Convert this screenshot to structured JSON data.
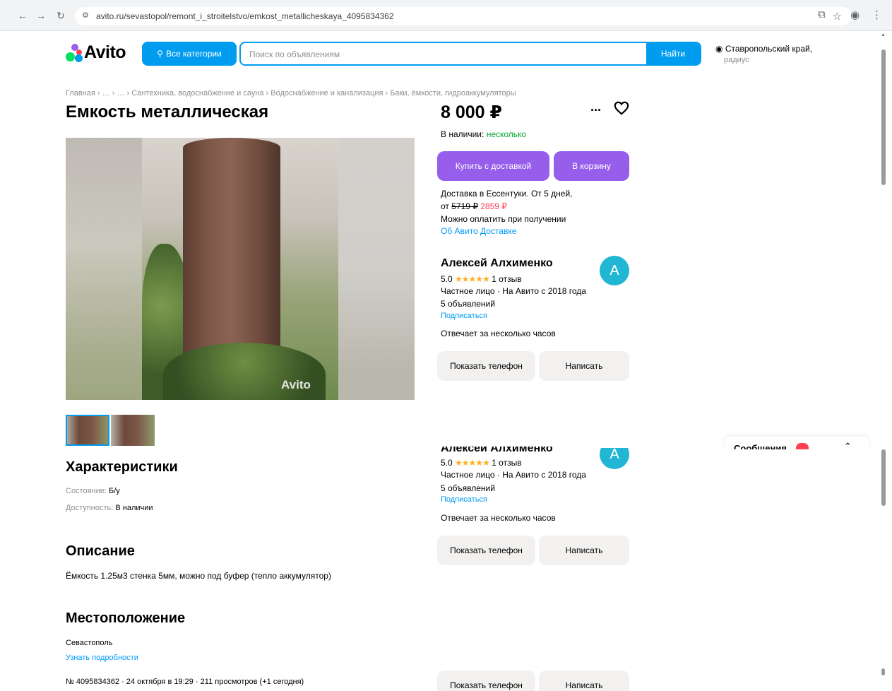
{
  "browser": {
    "url": "avito.ru/sevastopol/remont_i_stroitelstvo/emkost_metallicheskaya_4095834362"
  },
  "header": {
    "logo_text": "Avito",
    "categories_label": "Все категории",
    "search_placeholder": "Поиск по объявлениям",
    "search_button": "Найти",
    "region": "Ставропольский край,",
    "radius": "радиус"
  },
  "breadcrumb": "Главная › … › … › Сантехника, водоснабжение и сауна › Водоснабжение и канализация › Баки, ёмкости, гидроаккумуляторы",
  "listing": {
    "title": "Емкость металлическая",
    "price": "8 000 ₽",
    "availability_label": "В наличии:",
    "availability_value": "несколько",
    "buy_button": "Купить с доставкой",
    "cart_button": "В корзину",
    "delivery_line": "Доставка в Ессентуки. От 5 дней,",
    "price_from": "от",
    "old_price": "5719 ₽",
    "new_price": "2859 ₽",
    "pay_on_receipt": "Можно оплатить при получении",
    "about_delivery": "Об Авито Доставке",
    "watermark": "Avito"
  },
  "seller": {
    "name": "Алексей Алхименко",
    "avatar_letter": "A",
    "rating": "5.0",
    "stars": "★★★★★",
    "reviews": "1 отзыв",
    "type": "Частное лицо · На Авито с 2018 года",
    "ads": "5 объявлений",
    "subscribe": "Подписаться",
    "response": "Отвечает за несколько часов",
    "show_phone": "Показать телефон",
    "write": "Написать"
  },
  "characteristics": {
    "title": "Характеристики",
    "items": [
      {
        "label": "Состояние:",
        "value": "Б/у"
      },
      {
        "label": "Доступность:",
        "value": "В наличии"
      }
    ]
  },
  "description": {
    "title": "Описание",
    "text": "Ёмкость 1.25м3 стенка 5мм, можно под буфер (тепло аккумулятор)"
  },
  "location": {
    "title": "Местоположение",
    "city": "Севастополь",
    "details_link": "Узнать подробности"
  },
  "meta_line": "№ 4095834362 · 24 октября в 19:29 · 211 просмотров (+1 сегодня)",
  "messages": {
    "label": "Сообщения"
  },
  "colors": {
    "accent_blue": "#009cf0",
    "purple": "#965eeb",
    "green": "#02a82e",
    "red": "#ff4053"
  }
}
